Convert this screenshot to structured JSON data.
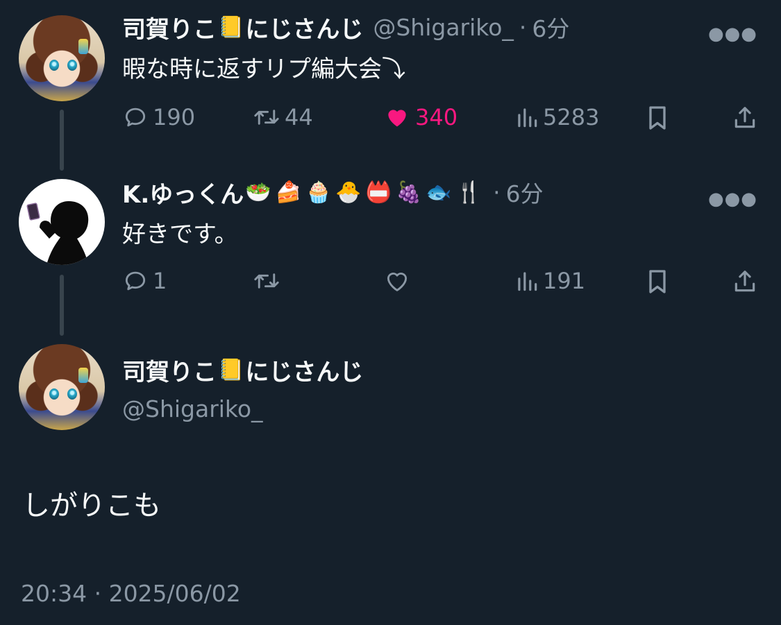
{
  "tweets": [
    {
      "display_name": "司賀りこ",
      "name_emoji": "📒",
      "name_suffix": "にじさんじ",
      "handle": "@Shigariko_",
      "separator": "·",
      "time": "6分",
      "text": "暇な時に返すリプ編大会⤵",
      "replies": "190",
      "retweets": "44",
      "likes": "340",
      "views": "5283",
      "liked": true
    },
    {
      "display_name": "K.ゆっくん",
      "name_emojis": "🥗🍰🧁🐣📛🍇🐟🍴",
      "separator": "·",
      "time": "6分",
      "text": "好きです。",
      "replies": "1",
      "retweets": "",
      "likes": "",
      "views": "191",
      "liked": false
    }
  ],
  "focused_tweet": {
    "display_name": "司賀りこ",
    "name_emoji": "📒",
    "name_suffix": "にじさんじ",
    "handle": "@Shigariko_",
    "text": "しがりこも",
    "timestamp": "20:34 · 2025/06/02"
  },
  "icons": {
    "reply": "reply-icon",
    "retweet": "retweet-icon",
    "like": "heart-icon",
    "views": "views-icon",
    "bookmark": "bookmark-icon",
    "share": "share-icon",
    "more": "more-icon"
  },
  "colors": {
    "background": "#15202b",
    "text": "#f7f9f9",
    "secondary": "#8b98a5",
    "like": "#f91880",
    "thread_line": "#38444d"
  }
}
